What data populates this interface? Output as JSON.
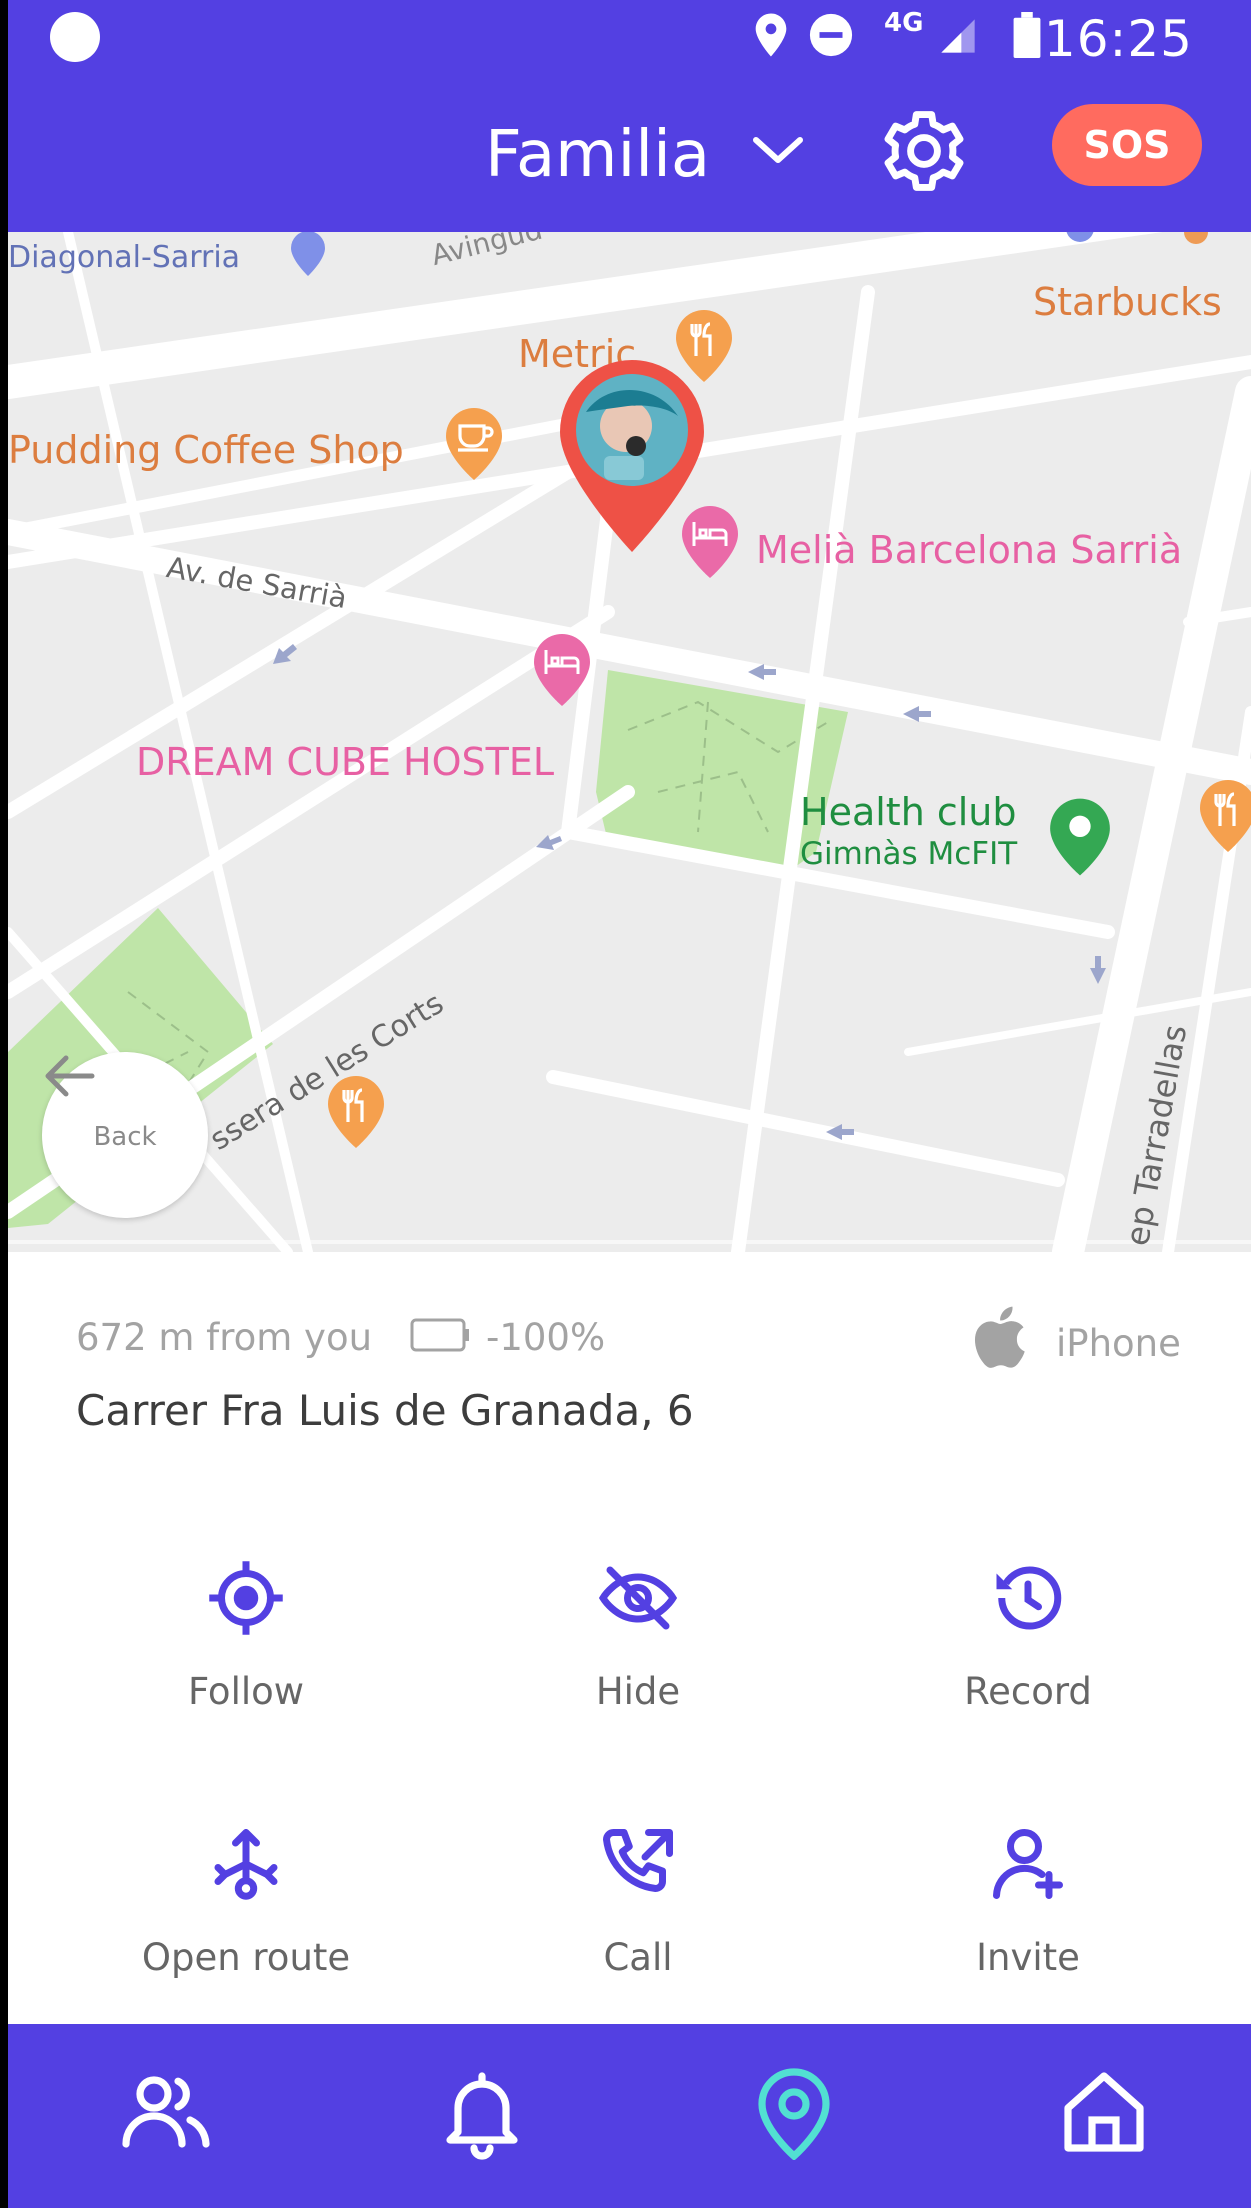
{
  "status_bar": {
    "network": "4G",
    "time": "16:25"
  },
  "header": {
    "group_name": "Familia",
    "sos_label": "SOS"
  },
  "map": {
    "labels": {
      "diagonal_sarria": "Diagonal-Sarria",
      "avinguda": "Avingud",
      "starbucks": "Starbucks",
      "metric": "Metric",
      "pudding": "Pudding Coffee Shop",
      "melia": "Melià Barcelona Sarrià",
      "av_sarria": "Av. de Sarrià",
      "dream_cube": "DREAM CUBE HOSTEL",
      "health_club": "Health club",
      "gimnas": "Gimnàs McFIT",
      "travessera": "ssera de les Corts",
      "tarradellas": "ep Tarradellas"
    },
    "back_label": "Back"
  },
  "info": {
    "distance": "672 m from you",
    "battery": "-100%",
    "device": "iPhone",
    "address": "Carrer Fra Luis de Granada, 6"
  },
  "actions": [
    {
      "label": "Follow",
      "icon": "target-icon"
    },
    {
      "label": "Hide",
      "icon": "eye-off-icon"
    },
    {
      "label": "Record",
      "icon": "history-icon"
    },
    {
      "label": "Open route",
      "icon": "route-icon"
    },
    {
      "label": "Call",
      "icon": "phone-outgoing-icon"
    },
    {
      "label": "Invite",
      "icon": "add-user-icon"
    }
  ],
  "bottom_nav": [
    {
      "name": "people-icon"
    },
    {
      "name": "bell-icon"
    },
    {
      "name": "location-pin-icon",
      "active": true
    },
    {
      "name": "home-icon"
    }
  ],
  "colors": {
    "primary": "#5340e2",
    "sos": "#ff6b5f",
    "active_nav": "#52e0d2",
    "pin": "#ee5146"
  }
}
